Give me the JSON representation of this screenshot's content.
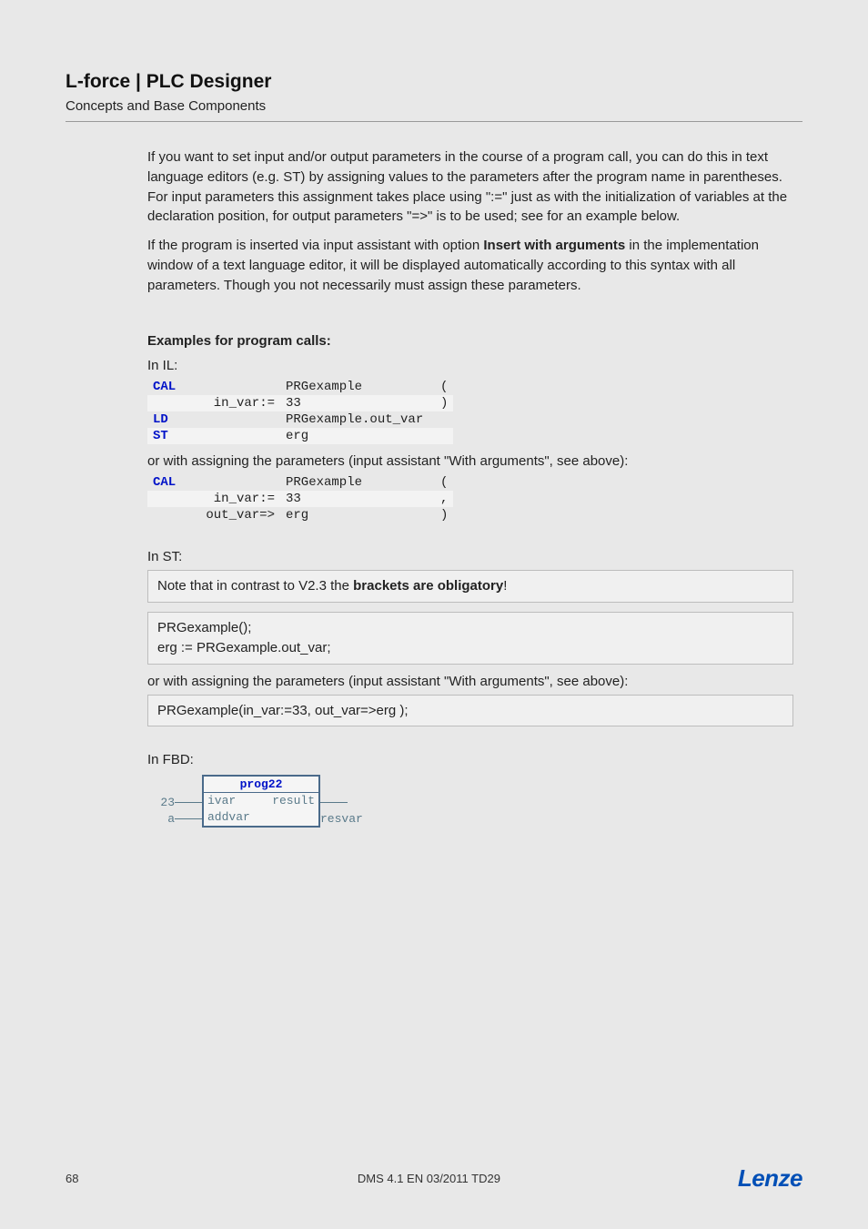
{
  "header": {
    "title": "L-force | PLC Designer",
    "subtitle": "Concepts and Base Components"
  },
  "body": {
    "p1": "If you want to set input and/or output parameters in the course of a program call, you can do this in text language editors (e.g. ST) by assigning values to the parameters after the program name in parentheses. For input parameters this assignment takes place using \":=\" just as with the initialization of variables at the declaration position, for output parameters \"=>\" is to be used; see for an example below.",
    "p2_a": "If the program is inserted via input assistant with option ",
    "p2_bold": "Insert with arguments",
    "p2_b": " in the implementation window of a text language editor, it will be displayed automatically according to this syntax with all parameters. Though you not necessarily must assign these parameters.",
    "sect_examples": "Examples for program calls:",
    "in_il": "In IL:",
    "or_assign": "or with assigning the parameters (input assistant \"With arguments\", see above):",
    "in_st": "In ST:",
    "st_note_a": " Note that in contrast to V2.3 the ",
    "st_note_bold": "brackets are obligatory",
    "st_note_b": "!",
    "st_code1": "PRGexample();",
    "st_code2": "erg := PRGexample.out_var;",
    "st_code3": "PRGexample(in_var:=33, out_var=>erg );",
    "in_fbd": "In FBD:"
  },
  "il1": [
    {
      "kw": "CAL",
      "op1": "",
      "op2": "PRGexample",
      "tail": "(",
      "stripe": false
    },
    {
      "kw": "",
      "op1": "in_var:=",
      "op2": "33",
      "tail": ")",
      "stripe": true
    },
    {
      "kw": "LD",
      "op1": "",
      "op2": "PRGexample.out_var",
      "tail": "",
      "stripe": false
    },
    {
      "kw": "ST",
      "op1": "",
      "op2": "erg",
      "tail": "",
      "stripe": true
    }
  ],
  "il2": [
    {
      "kw": "CAL",
      "op1": "",
      "op2": "PRGexample",
      "tail": "(",
      "stripe": false
    },
    {
      "kw": "",
      "op1": "in_var:=",
      "op2": "33",
      "tail": ",",
      "stripe": true
    },
    {
      "kw": "",
      "op1": "out_var=>",
      "op2": "erg",
      "tail": ")",
      "stripe": false
    }
  ],
  "fbd": {
    "block_name": "prog22",
    "left_in1_val": "23",
    "left_in2_val": "a",
    "in1": "ivar",
    "in2": "addvar",
    "out1": "result",
    "right_out": "resvar"
  },
  "footer": {
    "pageno": "68",
    "mid": "DMS 4.1 EN 03/2011 TD29",
    "logo": "Lenze"
  }
}
